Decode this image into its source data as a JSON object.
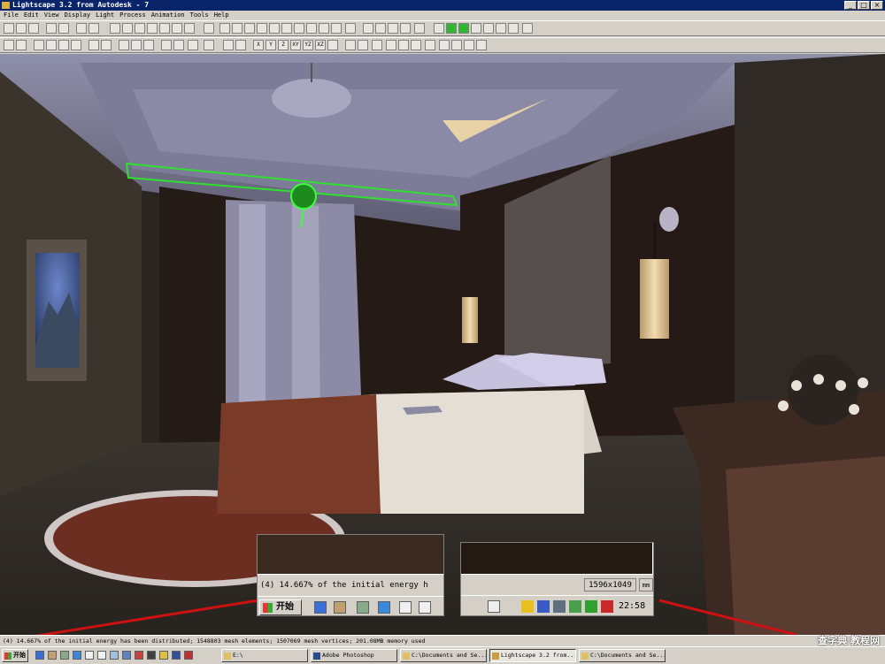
{
  "window": {
    "title": "Lightscape 3.2 from Autodesk - 7"
  },
  "menu": [
    "File",
    "Edit",
    "View",
    "Display",
    "Light",
    "Process",
    "Animation",
    "Tools",
    "Help"
  ],
  "toolbar_axis_labels": [
    "X",
    "Y",
    "Z",
    "XY",
    "YZ",
    "XZ"
  ],
  "status": {
    "text": "(4) 14.667% of the initial energy has been distributed; 1548803 mesh elements; 1507069 mesh vertices; 201.08MB memory used"
  },
  "taskbar": {
    "start_label": "开始",
    "tasks": [
      "E:\\",
      "Adobe Photoshop",
      "C:\\Documents and Se...",
      "Lightscape 3.2 from...",
      "C:\\Documents and Se..."
    ]
  },
  "inset_left": {
    "status_snippet": "(4) 14.667% of the initial energy h",
    "start_label": "开始"
  },
  "inset_right": {
    "dimensions": "1596x1049",
    "units": "mm",
    "clock": "22:58"
  },
  "watermark": "查字典 教程网"
}
